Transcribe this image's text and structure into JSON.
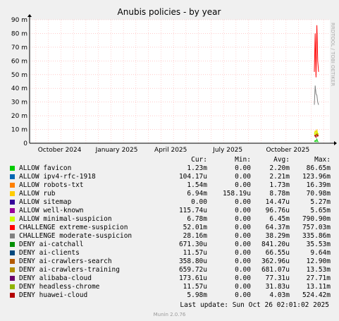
{
  "chart_data": {
    "type": "line",
    "title": "Anubis policies - by year",
    "y_ticks": [
      "0",
      "10 m",
      "20 m",
      "30 m",
      "40 m",
      "50 m",
      "60 m",
      "70 m",
      "80 m",
      "90 m"
    ],
    "ylim": [
      0,
      90
    ],
    "x_ticks": [
      "October 2024",
      "January 2025",
      "April 2025",
      "July 2025",
      "October 2025"
    ],
    "watermark": "RRDTOOL / TOBI OETIKER",
    "grid": true,
    "columns": [
      "Cur:",
      "Min:",
      "Avg:",
      "Max:"
    ],
    "series": [
      {
        "name": "ALLOW favicon",
        "color": "#00cc00",
        "cur": "1.23m",
        "min": "0.00",
        "avg": "2.20m",
        "max": "86.65m"
      },
      {
        "name": "ALLOW ipv4-rfc-1918",
        "color": "#0066b3",
        "cur": "104.17u",
        "min": "0.00",
        "avg": "2.21m",
        "max": "123.96m"
      },
      {
        "name": "ALLOW robots-txt",
        "color": "#ff8000",
        "cur": "1.54m",
        "min": "0.00",
        "avg": "1.73m",
        "max": "16.39m"
      },
      {
        "name": "ALLOW rub",
        "color": "#ffcc00",
        "cur": "6.94m",
        "min": "158.19u",
        "avg": "8.78m",
        "max": "70.98m"
      },
      {
        "name": "ALLOW sitemap",
        "color": "#330099",
        "cur": "0.00",
        "min": "0.00",
        "avg": "14.47u",
        "max": "5.27m"
      },
      {
        "name": "ALLOW well-known",
        "color": "#990099",
        "cur": "115.74u",
        "min": "0.00",
        "avg": "96.76u",
        "max": "5.65m"
      },
      {
        "name": "ALLOW minimal-suspicion",
        "color": "#ccff00",
        "cur": "6.78m",
        "min": "0.00",
        "avg": "6.45m",
        "max": "790.90m"
      },
      {
        "name": "CHALLENGE extreme-suspicion",
        "color": "#ff0000",
        "cur": "52.01m",
        "min": "0.00",
        "avg": "64.37m",
        "max": "757.03m"
      },
      {
        "name": "CHALLENGE moderate-suspicion",
        "color": "#808080",
        "cur": "28.16m",
        "min": "0.00",
        "avg": "38.29m",
        "max": "335.86m"
      },
      {
        "name": "DENY ai-catchall",
        "color": "#008f00",
        "cur": "671.30u",
        "min": "0.00",
        "avg": "841.20u",
        "max": "35.53m"
      },
      {
        "name": "DENY ai-clients",
        "color": "#00487d",
        "cur": "11.57u",
        "min": "0.00",
        "avg": "66.55u",
        "max": "9.64m"
      },
      {
        "name": "DENY ai-crawlers-search",
        "color": "#b35a00",
        "cur": "358.80u",
        "min": "0.00",
        "avg": "362.96u",
        "max": "12.90m"
      },
      {
        "name": "DENY ai-crawlers-training",
        "color": "#b38f00",
        "cur": "659.72u",
        "min": "0.00",
        "avg": "681.07u",
        "max": "13.53m"
      },
      {
        "name": "DENY alibaba-cloud",
        "color": "#6b006b",
        "cur": "173.61u",
        "min": "0.00",
        "avg": "77.31u",
        "max": "27.71m"
      },
      {
        "name": "DENY headless-chrome",
        "color": "#8fb300",
        "cur": "11.57u",
        "min": "0.00",
        "avg": "31.83u",
        "max": "13.11m"
      },
      {
        "name": "DENY huawei-cloud",
        "color": "#b30000",
        "cur": "5.98m",
        "min": "0.00",
        "avg": "4.03m",
        "max": "524.42m"
      }
    ],
    "last_update": "Last update:  Sun Oct 26 02:01:02 2025",
    "footer": "Munin 2.0.76"
  }
}
